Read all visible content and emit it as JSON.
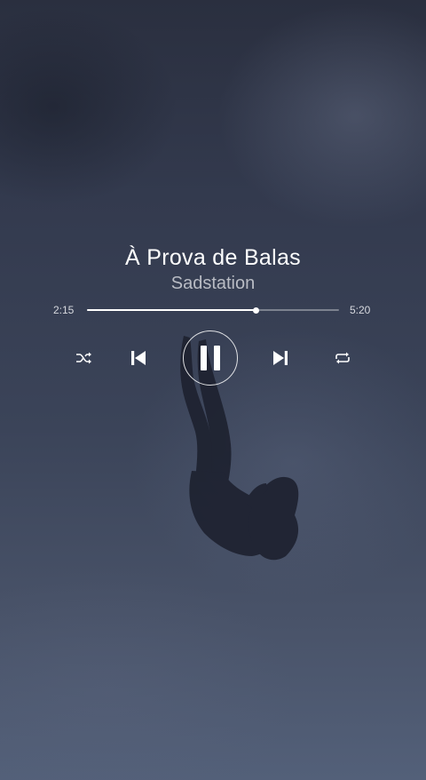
{
  "song": {
    "title": "À Prova de Balas",
    "artist": "Sadstation"
  },
  "progress": {
    "elapsed": "2:15",
    "total": "5:20",
    "fraction": 0.67
  },
  "controls": {
    "shuffle_icon": "shuffle-icon",
    "previous_icon": "skip-previous-icon",
    "play_state_icon": "pause-icon",
    "next_icon": "skip-next-icon",
    "repeat_icon": "repeat-icon"
  },
  "colors": {
    "background_top": "#2a2f3f",
    "background_bottom": "#536079",
    "text_primary": "#ffffff",
    "text_secondary": "#b9bcc4"
  }
}
